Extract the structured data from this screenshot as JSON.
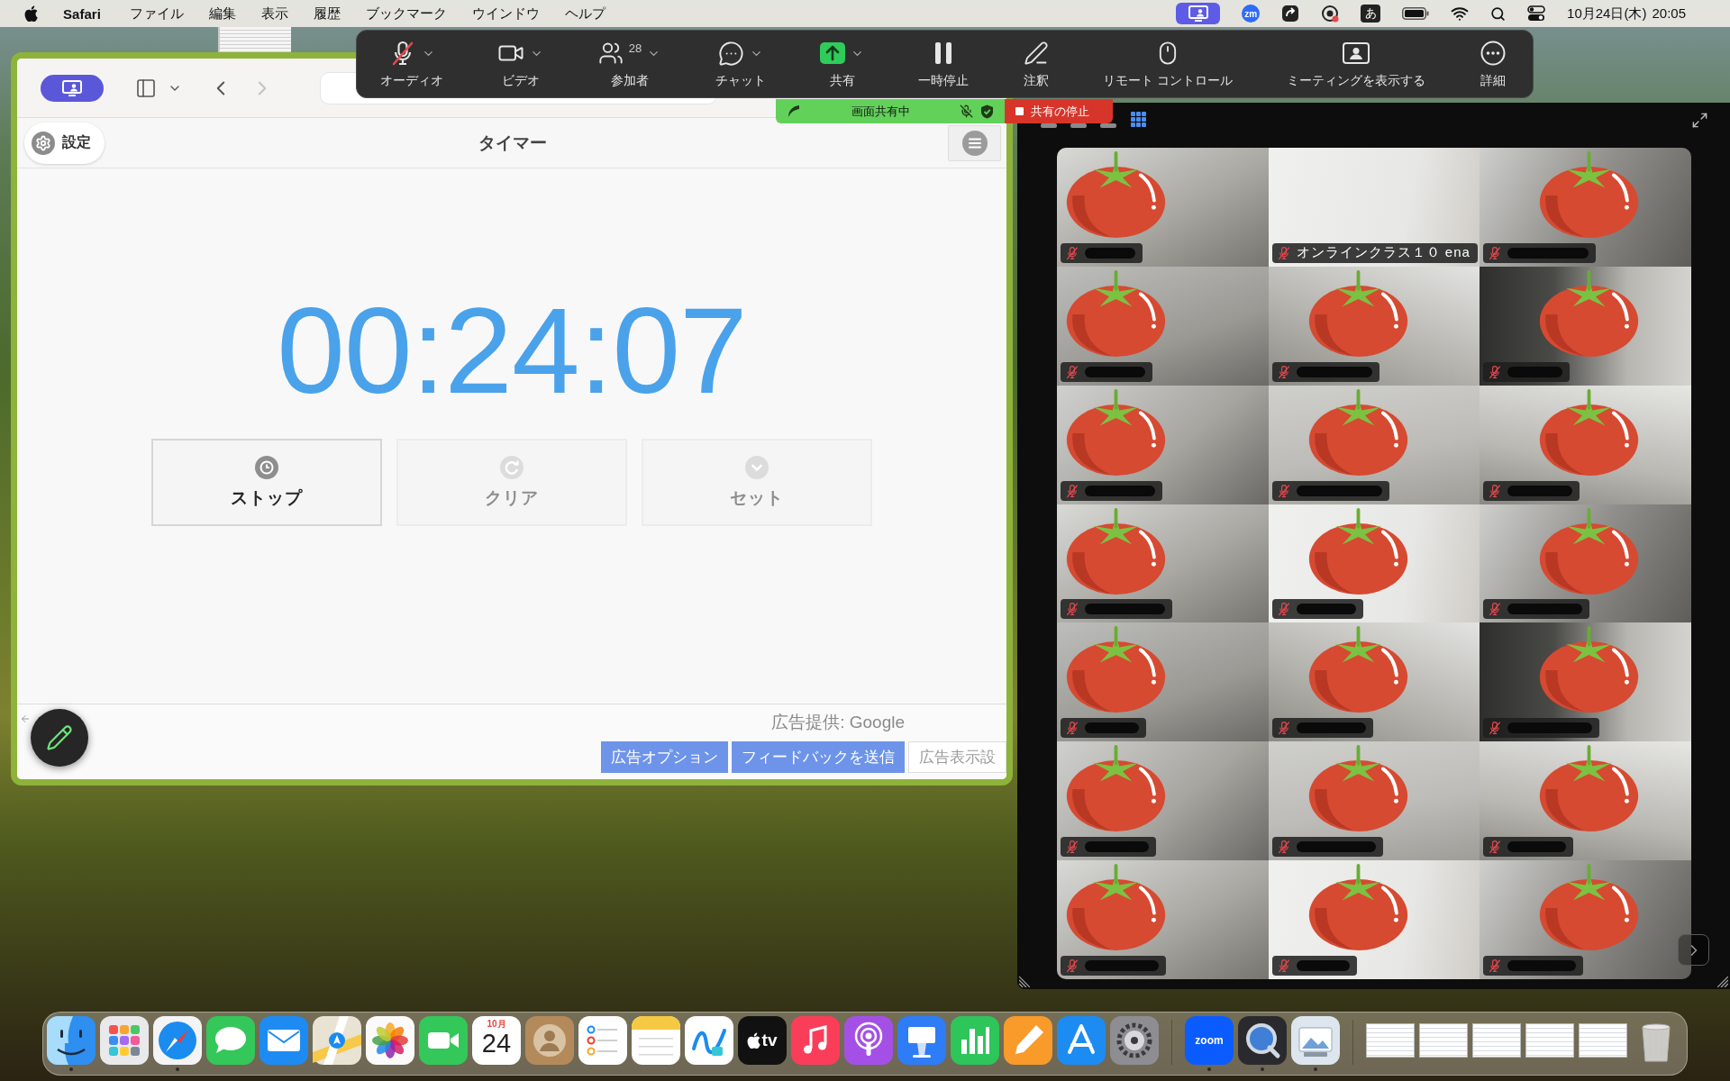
{
  "menu_bar": {
    "app_name": "Safari",
    "menus": [
      "ファイル",
      "編集",
      "表示",
      "履歴",
      "ブックマーク",
      "ウインドウ",
      "ヘルプ"
    ],
    "zoom_badge": "zm",
    "input_method": "あ",
    "date": "10月24日(木)",
    "time": "20:05"
  },
  "meeting_toolbar": {
    "items": [
      {
        "kind": "audio",
        "label": "オーディオ",
        "muted": true,
        "has_menu": true
      },
      {
        "kind": "video",
        "label": "ビデオ",
        "has_menu": true
      },
      {
        "kind": "participants",
        "label": "参加者",
        "count": "28",
        "has_menu": true
      },
      {
        "kind": "chat",
        "label": "チャット",
        "has_menu": true
      },
      {
        "kind": "share",
        "label": "共有",
        "has_menu": true
      },
      {
        "kind": "pause",
        "label": "一時停止",
        "has_menu": false
      },
      {
        "kind": "annotate",
        "label": "注釈",
        "has_menu": false
      },
      {
        "kind": "remote",
        "label": "リモート コントロール",
        "has_menu": false
      },
      {
        "kind": "view",
        "label": "ミーティングを表示する",
        "has_menu": false
      },
      {
        "kind": "more",
        "label": "詳細",
        "has_menu": false
      }
    ]
  },
  "share_banner": {
    "status": "画面共有中",
    "stop_label": "共有の停止"
  },
  "browser": {
    "back_disabled": false,
    "forward_disabled": true,
    "page": {
      "settings_label": "設定",
      "title": "タイマー",
      "time": "00:24:07",
      "buttons": [
        {
          "kind": "stop",
          "label": "ストップ",
          "disabled": false
        },
        {
          "kind": "clear",
          "label": "クリア",
          "disabled": true
        },
        {
          "kind": "set",
          "label": "セット",
          "disabled": true
        }
      ],
      "footer": {
        "provider": "広告提供: Google",
        "buttons": [
          {
            "kind": "filled",
            "label": "広告オプション"
          },
          {
            "kind": "filled",
            "label": "フィードバックを送信"
          },
          {
            "kind": "plain",
            "label": "広告表示設"
          }
        ]
      }
    }
  },
  "gallery": {
    "tiles": [
      {
        "kind": "covered",
        "muted": true
      },
      {
        "kind": "named",
        "name": "オンラインクラス１０ ena",
        "muted": true
      },
      {
        "kind": "covered",
        "muted": true
      },
      {
        "kind": "covered",
        "muted": true
      },
      {
        "kind": "covered",
        "muted": true
      },
      {
        "kind": "covered",
        "muted": true
      },
      {
        "kind": "covered",
        "muted": true
      },
      {
        "kind": "covered",
        "muted": true
      },
      {
        "kind": "covered",
        "muted": true
      },
      {
        "kind": "covered",
        "muted": true
      },
      {
        "kind": "covered",
        "muted": true
      },
      {
        "kind": "covered",
        "muted": true
      },
      {
        "kind": "covered",
        "muted": true
      },
      {
        "kind": "covered",
        "muted": true
      },
      {
        "kind": "covered",
        "muted": true
      },
      {
        "kind": "covered",
        "muted": true
      },
      {
        "kind": "covered",
        "muted": true
      },
      {
        "kind": "covered",
        "muted": true
      },
      {
        "kind": "covered",
        "muted": true
      },
      {
        "kind": "covered",
        "muted": true
      },
      {
        "kind": "covered",
        "muted": true
      }
    ]
  },
  "dock": {
    "groups": [
      {
        "items": [
          {
            "kind": "finder",
            "running": true
          },
          {
            "kind": "launchpad",
            "running": false
          },
          {
            "kind": "safari",
            "running": true
          },
          {
            "kind": "messages",
            "running": false
          },
          {
            "kind": "mail",
            "running": false
          },
          {
            "kind": "maps",
            "running": false
          },
          {
            "kind": "photos",
            "running": false
          },
          {
            "kind": "facetime",
            "running": false
          },
          {
            "kind": "calendar",
            "month": "10月",
            "day": "24",
            "running": false
          },
          {
            "kind": "contacts",
            "running": false
          },
          {
            "kind": "reminders",
            "running": false
          },
          {
            "kind": "notes",
            "running": false
          },
          {
            "kind": "freeform",
            "running": false
          },
          {
            "kind": "tv",
            "label": "tv",
            "running": false
          },
          {
            "kind": "music",
            "running": false
          },
          {
            "kind": "podcasts",
            "running": false
          },
          {
            "kind": "keynote",
            "running": false
          },
          {
            "kind": "numbers",
            "running": false
          },
          {
            "kind": "pages",
            "running": false
          },
          {
            "kind": "appstore",
            "running": false
          },
          {
            "kind": "settings",
            "running": false
          }
        ]
      },
      {
        "items": [
          {
            "kind": "zoom",
            "label": "zoom",
            "running": true
          },
          {
            "kind": "quicktime",
            "running": true
          },
          {
            "kind": "preview",
            "running": true
          }
        ]
      },
      {
        "items": [
          {
            "kind": "window",
            "running": false
          },
          {
            "kind": "window",
            "running": false
          },
          {
            "kind": "window",
            "running": false
          },
          {
            "kind": "window",
            "running": false
          },
          {
            "kind": "window",
            "running": false
          },
          {
            "kind": "trash",
            "running": false
          }
        ]
      }
    ]
  }
}
